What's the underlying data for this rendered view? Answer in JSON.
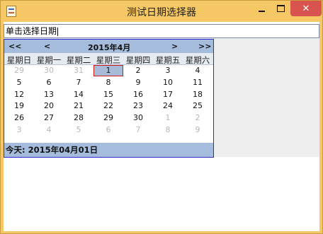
{
  "window": {
    "title": "测试日期选择器",
    "controls": {
      "minimize": "minimize",
      "maximize": "maximize",
      "close": "✕"
    }
  },
  "input": {
    "value": "单击选择日期"
  },
  "calendar": {
    "nav": {
      "prev_year": "<<",
      "prev_month": "<",
      "next_month": ">",
      "next_year": ">>"
    },
    "month_label": "2015年4月",
    "weekdays": [
      "星期日",
      "星期一",
      "星期二",
      "星期三",
      "星期四",
      "星期五",
      "星期六"
    ],
    "weeks": [
      [
        {
          "d": "29",
          "other": true
        },
        {
          "d": "30",
          "other": true
        },
        {
          "d": "31",
          "other": true
        },
        {
          "d": "1",
          "selected": true
        },
        {
          "d": "2"
        },
        {
          "d": "3"
        },
        {
          "d": "4"
        }
      ],
      [
        {
          "d": "5"
        },
        {
          "d": "6"
        },
        {
          "d": "7"
        },
        {
          "d": "8"
        },
        {
          "d": "9"
        },
        {
          "d": "10"
        },
        {
          "d": "11"
        }
      ],
      [
        {
          "d": "12"
        },
        {
          "d": "13"
        },
        {
          "d": "14"
        },
        {
          "d": "15"
        },
        {
          "d": "16"
        },
        {
          "d": "17"
        },
        {
          "d": "18"
        }
      ],
      [
        {
          "d": "19"
        },
        {
          "d": "20"
        },
        {
          "d": "21"
        },
        {
          "d": "22"
        },
        {
          "d": "23"
        },
        {
          "d": "24"
        },
        {
          "d": "25"
        }
      ],
      [
        {
          "d": "26"
        },
        {
          "d": "27"
        },
        {
          "d": "28"
        },
        {
          "d": "29"
        },
        {
          "d": "30"
        },
        {
          "d": "1",
          "other": true
        },
        {
          "d": "2",
          "other": true
        }
      ],
      [
        {
          "d": "3",
          "other": true
        },
        {
          "d": "4",
          "other": true
        },
        {
          "d": "5",
          "other": true
        },
        {
          "d": "6",
          "other": true
        },
        {
          "d": "7",
          "other": true
        },
        {
          "d": "8",
          "other": true
        },
        {
          "d": "9",
          "other": true
        }
      ]
    ],
    "today_label": "今天: 2015年04月01日"
  },
  "colors": {
    "titlebar": "#f6c865",
    "header": "#a5bcdc",
    "selected": "#a7bbd6",
    "selected_border": "#d01818",
    "calendar_border": "#2a2ad0",
    "close_button": "#d9534f"
  }
}
